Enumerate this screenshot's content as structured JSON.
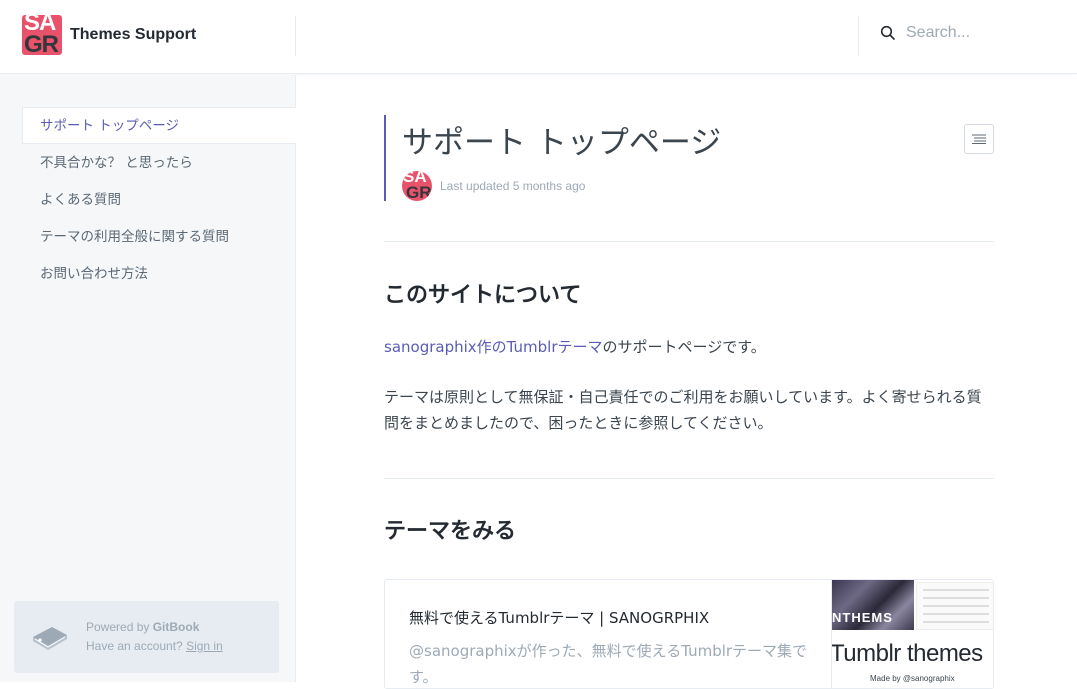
{
  "header": {
    "logo_line1": "SA",
    "logo_line2": "GR",
    "site_title": "Themes Support",
    "search_placeholder": "Search..."
  },
  "sidebar": {
    "items": [
      {
        "label": "サポート トップページ",
        "active": true
      },
      {
        "label": "不具合かな？ と思ったら",
        "active": false
      },
      {
        "label": "よくある質問",
        "active": false
      },
      {
        "label": "テーマの利用全般に関する質問",
        "active": false
      },
      {
        "label": "お問い合わせ方法",
        "active": false
      }
    ],
    "footer": {
      "powered_prefix": "Powered by ",
      "powered_brand": "GitBook",
      "account_prompt": "Have an account? ",
      "sign_in": "Sign in"
    }
  },
  "page": {
    "title": "サポート トップページ",
    "last_updated": "Last updated 5 months ago",
    "section1": {
      "heading": "このサイトについて",
      "link_text": "sanographix作のTumblrテーマ",
      "para1_rest": "のサポートページです。",
      "para2": "テーマは原則として無保証・自己責任でのご利用をお願いしています。よく寄せられる質問をまとめましたので、困ったときに参照してください。"
    },
    "section2": {
      "heading": "テーマをみる",
      "card": {
        "title": "無料で使えるTumblrテーマ | SANOGRPHIX",
        "description": "@sanographixが作った、無料で使えるTumblrテーマ集です。",
        "thumb_photo_text": "NTHEMS",
        "thumb_big_text": "Tumblr themes",
        "thumb_small_text": "Made by @sanographix"
      }
    }
  },
  "colors": {
    "accent": "#5b5bb5",
    "brand": "#e9526b",
    "sidebar_bg": "#f5f7f9",
    "text": "#3b454e",
    "muted": "#9daab6"
  },
  "icons": {
    "search": "search-icon",
    "toc": "list-icon",
    "gitbook": "book-icon"
  }
}
